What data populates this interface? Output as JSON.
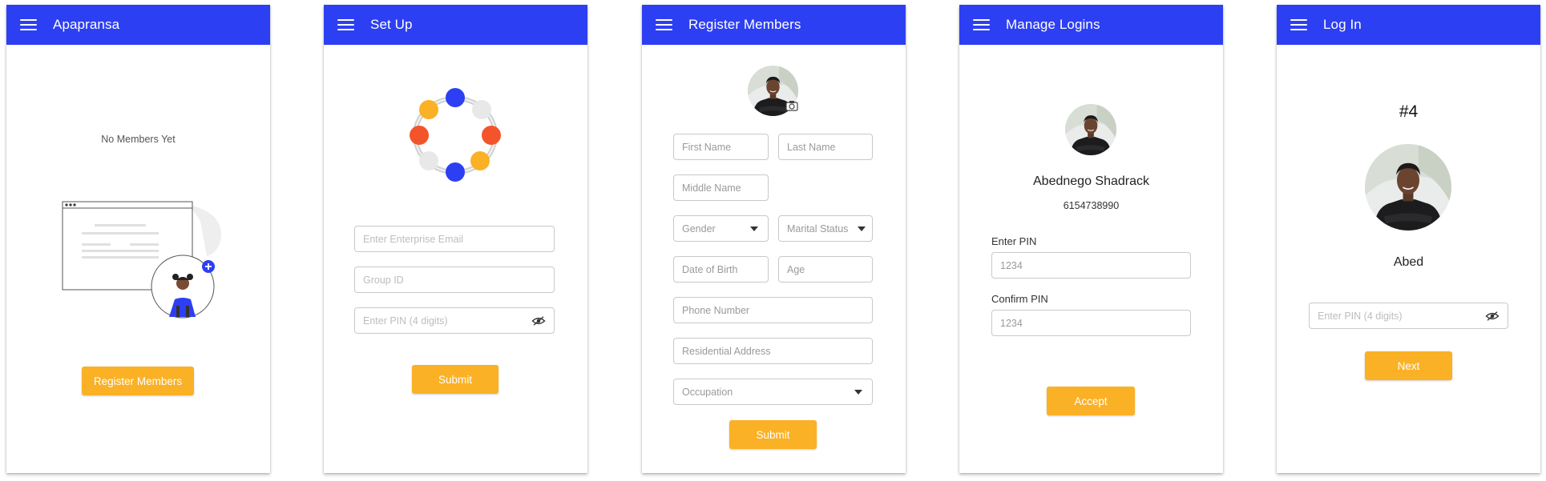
{
  "screens": [
    {
      "title": "Apapransa",
      "empty_text": "No Members Yet",
      "button": "Register Members"
    },
    {
      "title": "Set Up",
      "email_placeholder": "Enter Enterprise Email",
      "group_placeholder": "Group ID",
      "pin_placeholder": "Enter PIN (4 digits)",
      "button": "Submit"
    },
    {
      "title": "Register Members",
      "first_name": "First Name",
      "last_name": "Last Name",
      "middle_name": "Middle Name",
      "gender": "Gender",
      "marital_status": "Marital Status",
      "dob": "Date of Birth",
      "age": "Age",
      "phone": "Phone Number",
      "address": "Residential Address",
      "occupation": "Occupation",
      "button": "Submit"
    },
    {
      "title": "Manage Logins",
      "member_name": "Abednego Shadrack",
      "member_phone": "6154738990",
      "enter_pin_label": "Enter PIN",
      "enter_pin_placeholder": "1234",
      "confirm_pin_label": "Confirm PIN",
      "confirm_pin_placeholder": "1234",
      "button": "Accept"
    },
    {
      "title": "Log In",
      "number": "#4",
      "user_name": "Abed",
      "pin_placeholder": "Enter PIN (4 digits)",
      "button": "Next"
    }
  ],
  "colors": {
    "appbar": "#2d3ff2",
    "accent": "#fbb125",
    "orange": "#f4542b",
    "grey_dot": "#e6e6e6"
  },
  "icons": [
    "menu-icon",
    "camera-icon",
    "eye-off-icon",
    "dropdown-caret-icon",
    "add-icon"
  ]
}
